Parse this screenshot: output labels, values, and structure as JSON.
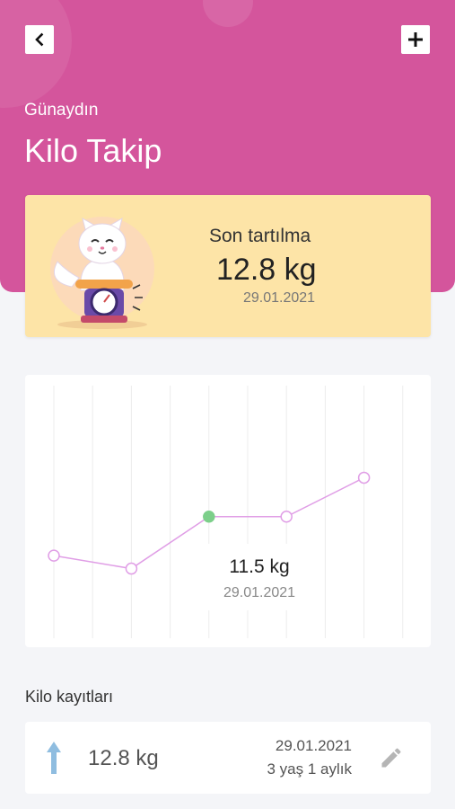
{
  "header": {
    "greeting": "Günaydın",
    "title": "Kilo Takip",
    "back_icon": "chevron-left-icon",
    "add_icon": "plus-icon",
    "color": "#d4559c"
  },
  "summary": {
    "label": "Son tartılma",
    "value": "12.8 kg",
    "date": "29.01.2021",
    "color": "#fde4a7",
    "illustration": "cat-on-scale-illustration"
  },
  "chart_data": {
    "type": "line",
    "x": [
      1,
      2,
      3,
      4,
      5
    ],
    "values": [
      11.6,
      11.4,
      12.2,
      12.2,
      12.8
    ],
    "selected_index": 2,
    "grid": "vertical",
    "line_color": "#e09ee6",
    "selected_color": "#7ccf8a",
    "tooltip": {
      "value": "11.5 kg",
      "date": "29.01.2021"
    }
  },
  "records": {
    "title": "Kilo kayıtları",
    "items": [
      {
        "trend_icon": "arrow-up-icon",
        "weight": "12.8 kg",
        "date": "29.01.2021",
        "age": "3 yaş 1 aylık",
        "edit_icon": "pencil-icon"
      }
    ]
  }
}
